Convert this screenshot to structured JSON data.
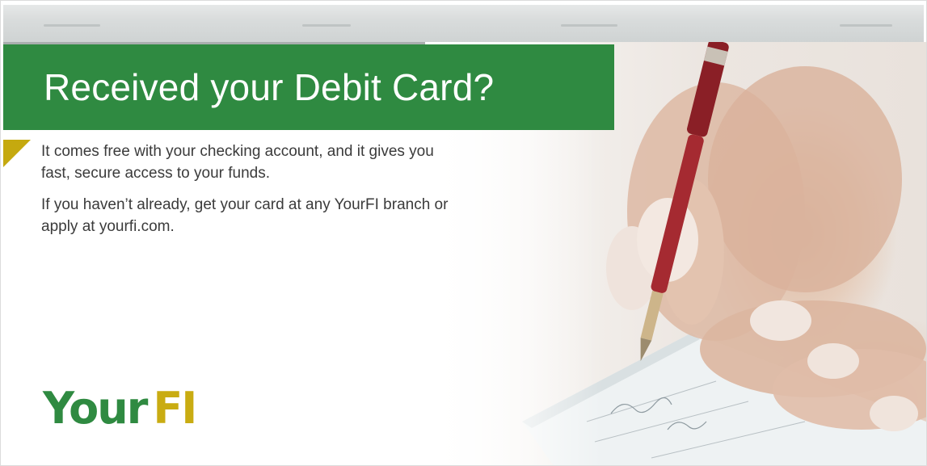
{
  "banner": {
    "headline": "Received your Debit Card?"
  },
  "body": {
    "paragraph_1": "It comes free with your checking account, and it gives you fast, secure access to your funds.",
    "paragraph_2": "If you haven’t already, get your card at any YourFI branch or apply at yourfi.com."
  },
  "logo": {
    "part_1": "Your",
    "part_2": "FI"
  },
  "colors": {
    "brand_green": "#2f8a41",
    "brand_gold": "#c9ac12",
    "text": "#3b3b3b"
  },
  "image": {
    "subject": "hand-writing-check-with-pen"
  }
}
